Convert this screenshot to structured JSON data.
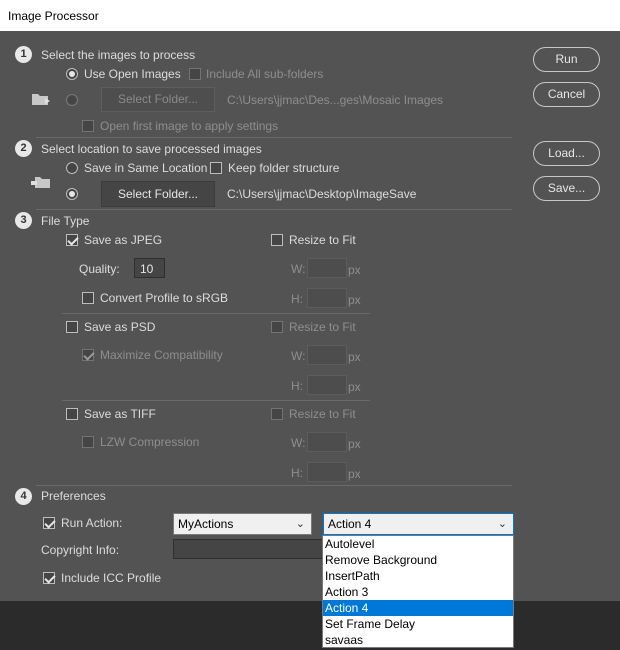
{
  "window": {
    "title": "Image Processor"
  },
  "section1": {
    "number": "1",
    "heading": "Select the images to process",
    "use_open_images": "Use Open Images",
    "include_subfolders": "Include All sub-folders",
    "select_folder": "Select Folder...",
    "folder_path": "C:\\Users\\jjmac\\Des...ges\\Mosaic Images",
    "open_first_image": "Open first image to apply settings"
  },
  "section2": {
    "number": "2",
    "heading": "Select location to save processed images",
    "save_same_location": "Save in Same Location",
    "keep_structure": "Keep folder structure",
    "select_folder": "Select Folder...",
    "folder_path": "C:\\Users\\jjmac\\Desktop\\ImageSave"
  },
  "section3": {
    "number": "3",
    "heading": "File Type",
    "jpeg": {
      "label": "Save as JPEG",
      "resize": "Resize to Fit",
      "quality_label": "Quality:",
      "quality_value": "10",
      "convert_profile": "Convert Profile to sRGB",
      "w_label": "W:",
      "h_label": "H:",
      "unit": "px"
    },
    "psd": {
      "label": "Save as PSD",
      "resize": "Resize to Fit",
      "maximize": "Maximize Compatibility",
      "w_label": "W:",
      "h_label": "H:",
      "unit": "px"
    },
    "tiff": {
      "label": "Save as TIFF",
      "resize": "Resize to Fit",
      "lzw": "LZW Compression",
      "w_label": "W:",
      "h_label": "H:",
      "unit": "px"
    }
  },
  "section4": {
    "number": "4",
    "heading": "Preferences",
    "run_action_label": "Run Action:",
    "action_set": "MyActions",
    "action": "Action 4",
    "copyright_label": "Copyright Info:",
    "include_icc": "Include ICC Profile"
  },
  "action_options": [
    "Autolevel",
    "Remove  Background",
    "InsertPath",
    "Action 3",
    "Action 4",
    "Set Frame Delay",
    "savaas"
  ],
  "buttons": {
    "run": "Run",
    "cancel": "Cancel",
    "load": "Load...",
    "save": "Save..."
  },
  "colors": {
    "dialog_bg": "#535353",
    "accent": "#0078d7"
  }
}
